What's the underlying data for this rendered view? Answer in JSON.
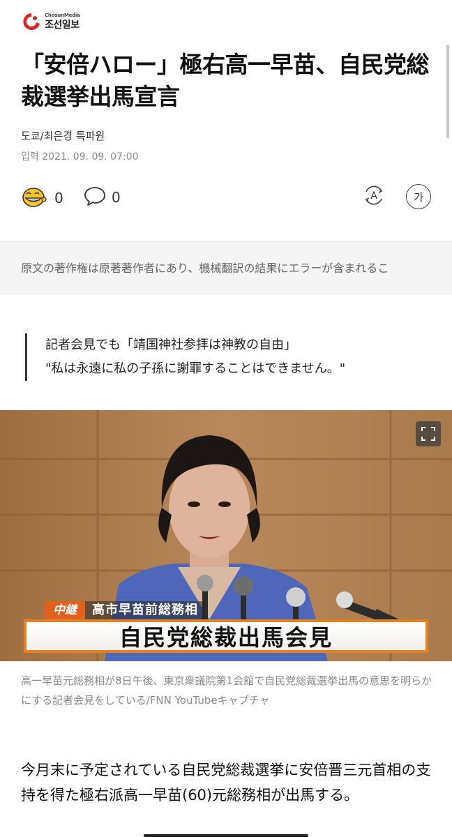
{
  "brand": {
    "sub": "ChosunMedia",
    "name": "조선일보",
    "accent_color": "#d42a26"
  },
  "article": {
    "headline": "「安倍ハロー」極右高一早苗、自民党総裁選挙出馬宣言",
    "byline": "도쿄/최은경 특파원",
    "dateline": "입력  2021. 09. 09. 07:00"
  },
  "actions": {
    "emoji_reaction": {
      "icon": "laughing-face-icon",
      "count": "0"
    },
    "comment": {
      "icon": "speech-bubble-icon",
      "count": "0"
    },
    "tts": {
      "icon": "read-aloud-icon",
      "label": "A"
    },
    "font_size": {
      "icon": "font-size-icon",
      "label": "가"
    }
  },
  "notice": {
    "text": "原文の著作権は原著著作者にあり、機械翻訳の結果にエラーが含まれるこ"
  },
  "quote": {
    "line1": "記者会見でも「靖国神社参拝は神教の自由」",
    "line2": "\"私は永遠に私の子孫に謝罪することはできません。\""
  },
  "photo": {
    "expand_icon": "fullscreen-icon",
    "tv_tag": "中継",
    "tv_subtitle": "高市早苗前総務相",
    "tv_banner": "自民党総裁出馬会見",
    "banner_color": "#e58225"
  },
  "caption": "高一早苗元総務相が8日午後、東京衆議院第1会館で自民党総裁選挙出馬の意思を明らかにする記者会見をしている/FNN YouTubeキャプチャ",
  "body": {
    "paragraph": "今月末に予定されている自民党総裁選挙に安倍晋三元首相の支持を得た極右派高一早苗(60)元総務相が出馬する。"
  }
}
